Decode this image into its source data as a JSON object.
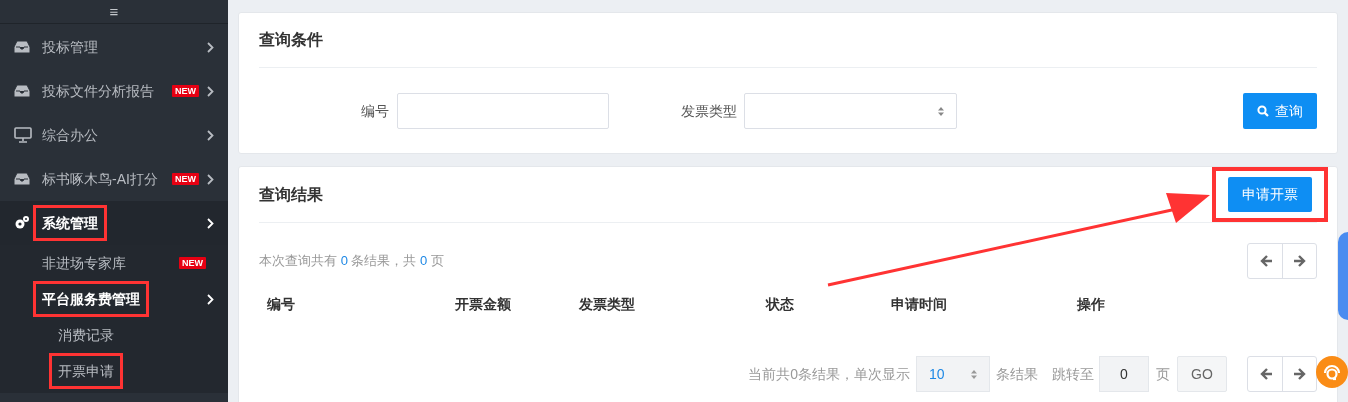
{
  "sidebar": {
    "menu_glyph": "≡",
    "items": [
      {
        "label": "投标管理",
        "kind": "inbox",
        "expanded": false,
        "highlighted": false
      },
      {
        "label": "投标文件分析报告",
        "kind": "inbox",
        "badge": "NEW",
        "expanded": false,
        "highlighted": false
      },
      {
        "label": "综合办公",
        "kind": "monitor",
        "expanded": false,
        "highlighted": false
      },
      {
        "label": "标书啄木鸟-AI打分",
        "kind": "inbox",
        "badge": "NEW",
        "expanded": false,
        "highlighted": false
      },
      {
        "label": "系统管理",
        "kind": "gears",
        "expanded": true,
        "highlighted": true,
        "children": [
          {
            "label": "非进场专家库",
            "badge": "NEW",
            "highlighted": false
          },
          {
            "label": "平台服务费管理",
            "expanded": true,
            "highlighted": true,
            "children": [
              {
                "label": "消费记录",
                "highlighted": false
              },
              {
                "label": "开票申请",
                "highlighted": true
              }
            ]
          }
        ]
      }
    ]
  },
  "search_panel": {
    "title": "查询条件",
    "fields": [
      {
        "kind": "text",
        "label": "编号"
      },
      {
        "kind": "select",
        "label": "发票类型"
      }
    ],
    "button": "查询"
  },
  "results_panel": {
    "title": "查询结果",
    "action_button": {
      "label": "申请开票",
      "highlighted": true
    },
    "annotation_arrow": true,
    "summary": {
      "prefix": "本次查询共有",
      "count": "0",
      "middle": "条结果，共",
      "pages": "0",
      "suffix": "页"
    },
    "columns": [
      "编号",
      "开票金额",
      "发票类型",
      "状态",
      "申请时间",
      "操作"
    ],
    "footer": {
      "total_text": "当前共0条结果，单次显示",
      "page_size": "10",
      "size_suffix": "条结果",
      "jump_label": "跳转至",
      "jump_value": "0",
      "page_suffix": "页",
      "go": "GO"
    }
  }
}
